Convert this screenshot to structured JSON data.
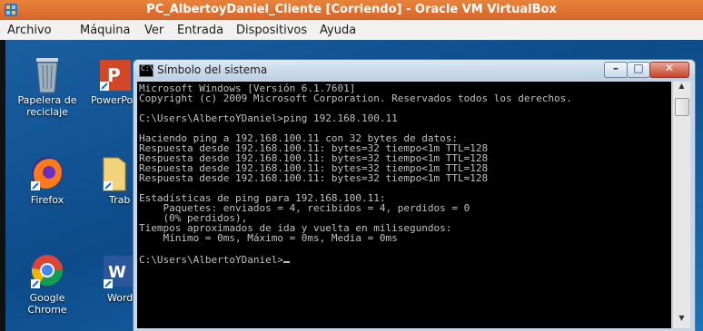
{
  "host": {
    "title": "PC_AlbertoyDaniel_Cliente [Corriendo] - Oracle VM VirtualBox",
    "menu": [
      "Archivo",
      "Máquina",
      "Ver",
      "Entrada",
      "Dispositivos",
      "Ayuda"
    ],
    "title_color": "#d7642a"
  },
  "desktop": {
    "icons": [
      {
        "label": "Papelera de reciclaje",
        "icon": "recycle-bin-icon"
      },
      {
        "label": "PowerPo",
        "icon": "powerpoint-icon"
      },
      {
        "label": "Firefox",
        "icon": "firefox-icon"
      },
      {
        "label": "Trab",
        "icon": "folder-icon"
      },
      {
        "label": "Google Chrome",
        "icon": "chrome-icon"
      },
      {
        "label": "Word",
        "icon": "word-icon"
      }
    ]
  },
  "cmd": {
    "title": "Símbolo del sistema",
    "lines": [
      "Microsoft Windows [Versión 6.1.7601]",
      "Copyright (c) 2009 Microsoft Corporation. Reservados todos los derechos.",
      "",
      "C:\\Users\\AlbertoYDaniel>ping 192.168.100.11",
      "",
      "Haciendo ping a 192.168.100.11 con 32 bytes de datos:",
      "Respuesta desde 192.168.100.11: bytes=32 tiempo<1m TTL=128",
      "Respuesta desde 192.168.100.11: bytes=32 tiempo<1m TTL=128",
      "Respuesta desde 192.168.100.11: bytes=32 tiempo<1m TTL=128",
      "Respuesta desde 192.168.100.11: bytes=32 tiempo<1m TTL=128",
      "",
      "Estadísticas de ping para 192.168.100.11:",
      "    Paquetes: enviados = 4, recibidos = 4, perdidos = 0",
      "    (0% perdidos),",
      "Tiempos aproximados de ida y vuelta en milisegundos:",
      "    Mínimo = 0ms, Máximo = 0ms, Media = 0ms",
      ""
    ],
    "prompt": "C:\\Users\\AlbertoYDaniel>"
  }
}
